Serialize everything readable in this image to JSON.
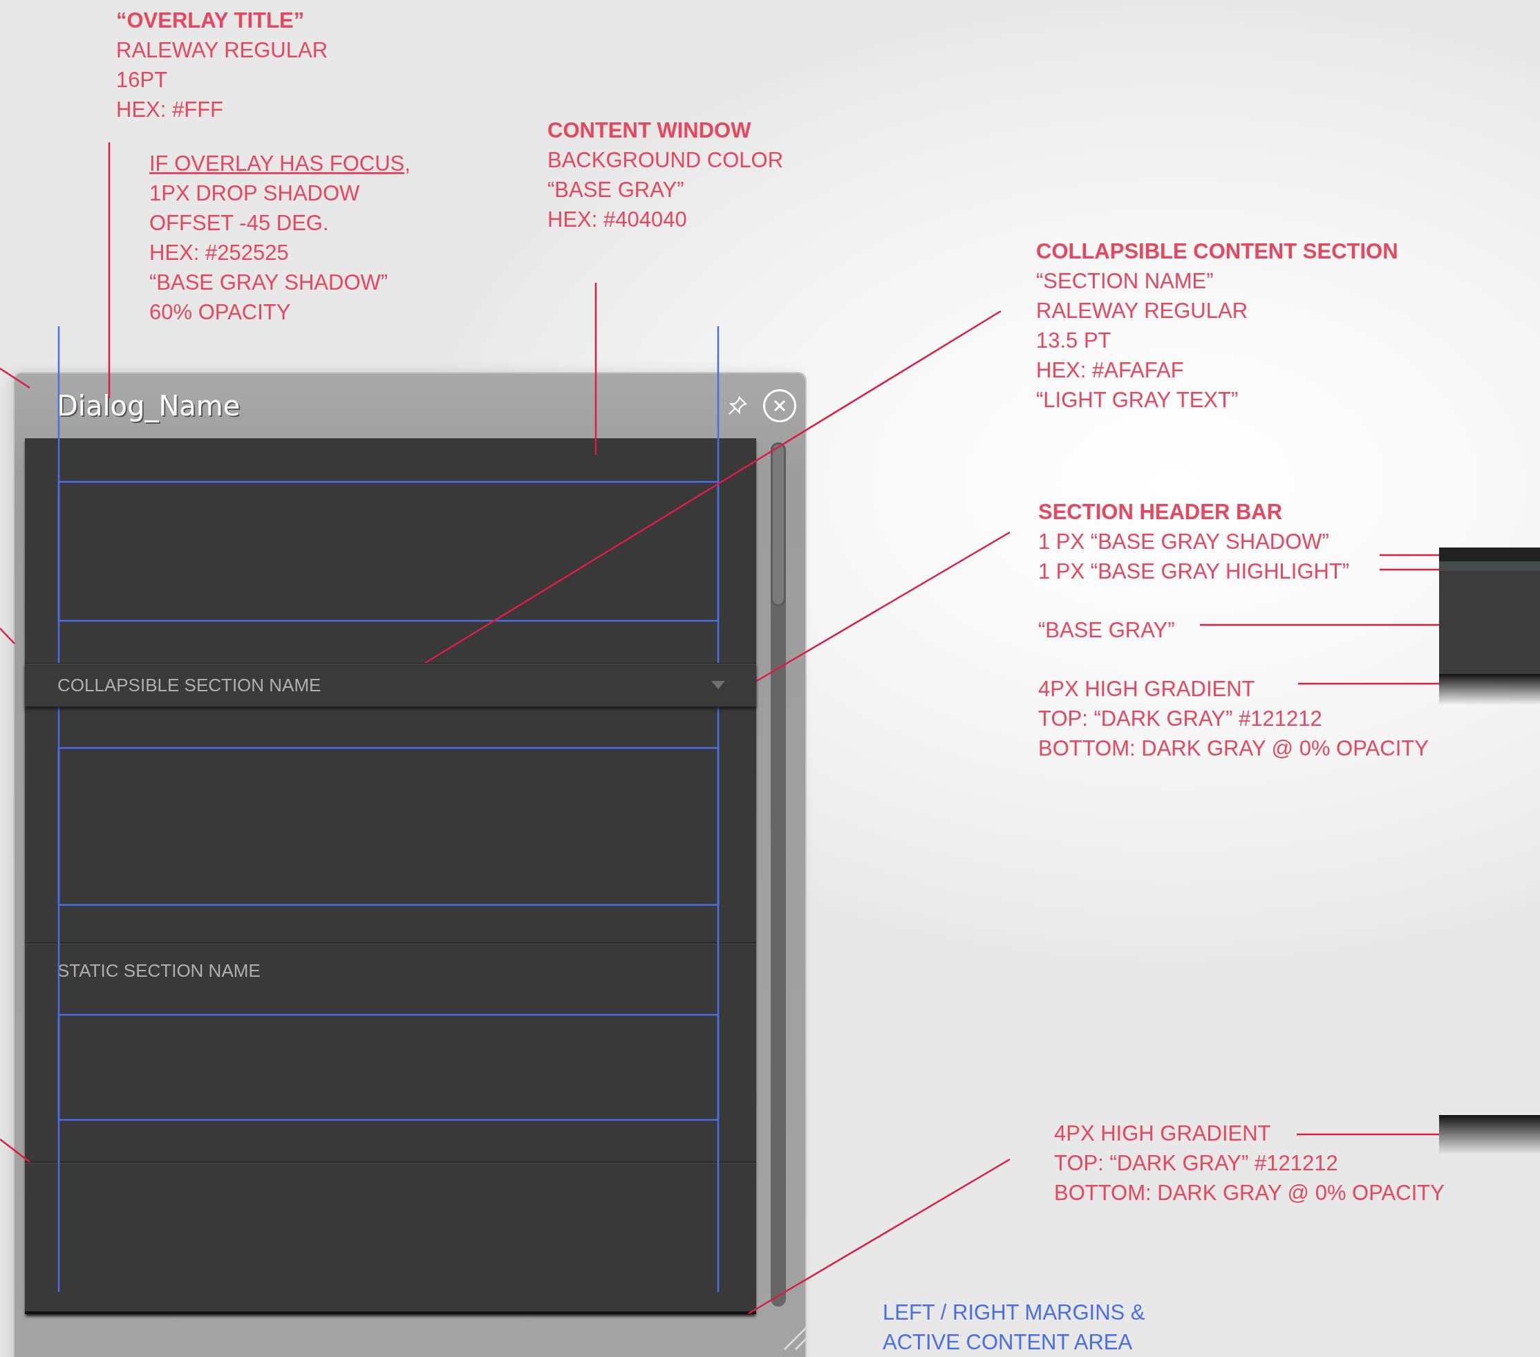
{
  "dialog": {
    "title": "Dialog_Name",
    "sections": [
      {
        "kind": "collapsible",
        "name": "COLLAPSIBLE SECTION NAME",
        "expanded": true
      },
      {
        "kind": "static",
        "name": "STATIC SECTION NAME"
      }
    ]
  },
  "annotations": [
    {
      "color": "#e5475e",
      "lines": [
        {
          "text": "“OVERLAY TITLE”",
          "kind": "heading"
        },
        {
          "text": "RALEWAY REGULAR",
          "kind": "line"
        },
        {
          "text": "16PT",
          "kind": "line"
        },
        {
          "text": "HEX: #FFF",
          "kind": "line"
        }
      ]
    },
    {
      "color": "#e5475e",
      "lines": [
        {
          "text": "IF OVERLAY HAS FOCUS,",
          "kind": "condition"
        },
        {
          "text": "1PX DROP SHADOW",
          "kind": "line"
        },
        {
          "text": "OFFSET -45 DEG.",
          "kind": "line"
        },
        {
          "text": "HEX: #252525",
          "kind": "line"
        },
        {
          "text": "“BASE GRAY SHADOW”",
          "kind": "line"
        },
        {
          "text": "60% OPACITY",
          "kind": "line"
        }
      ]
    },
    {
      "color": "#e5475e",
      "lines": [
        {
          "text": "CONTENT WINDOW",
          "kind": "heading"
        },
        {
          "text": "BACKGROUND COLOR",
          "kind": "line"
        },
        {
          "text": "“BASE GRAY”",
          "kind": "line"
        },
        {
          "text": "HEX: #404040",
          "kind": "line"
        }
      ]
    },
    {
      "color": "#e5475e",
      "lines": [
        {
          "text": "COLLAPSIBLE CONTENT SECTION",
          "kind": "heading"
        },
        {
          "text": "“SECTION NAME”",
          "kind": "line"
        },
        {
          "text": "RALEWAY REGULAR",
          "kind": "line"
        },
        {
          "text": "13.5 PT",
          "kind": "line"
        },
        {
          "text": "HEX: #AFAFAF",
          "kind": "line"
        },
        {
          "text": "“LIGHT GRAY TEXT”",
          "kind": "line"
        }
      ]
    },
    {
      "color": "#e5475e",
      "lines": [
        {
          "text": "SECTION HEADER BAR",
          "kind": "heading"
        },
        {
          "text": "1 PX “BASE GRAY SHADOW”",
          "kind": "line"
        },
        {
          "text": "1 PX “BASE GRAY HIGHLIGHT”",
          "kind": "line"
        }
      ]
    },
    {
      "color": "#e5475e",
      "lines": [
        {
          "text": "“BASE GRAY”",
          "kind": "line"
        }
      ]
    },
    {
      "color": "#e5475e",
      "lines": [
        {
          "text": "4PX HIGH GRADIENT",
          "kind": "line"
        },
        {
          "text": "TOP:  “DARK GRAY” #121212",
          "kind": "line"
        },
        {
          "text": "BOTTOM: DARK GRAY @ 0% OPACITY",
          "kind": "line"
        }
      ]
    },
    {
      "color": "#e5475e",
      "lines": [
        {
          "text": "4PX HIGH GRADIENT",
          "kind": "line"
        },
        {
          "text": "TOP:  “DARK GRAY” #121212",
          "kind": "line"
        },
        {
          "text": "BOTTOM: DARK GRAY @ 0% OPACITY",
          "kind": "line"
        }
      ]
    },
    {
      "color": "#4a6ee8",
      "lines": [
        {
          "text": "LEFT / RIGHT MARGINS &",
          "kind": "line"
        },
        {
          "text": "ACTIVE CONTENT AREA",
          "kind": "line"
        }
      ]
    }
  ]
}
